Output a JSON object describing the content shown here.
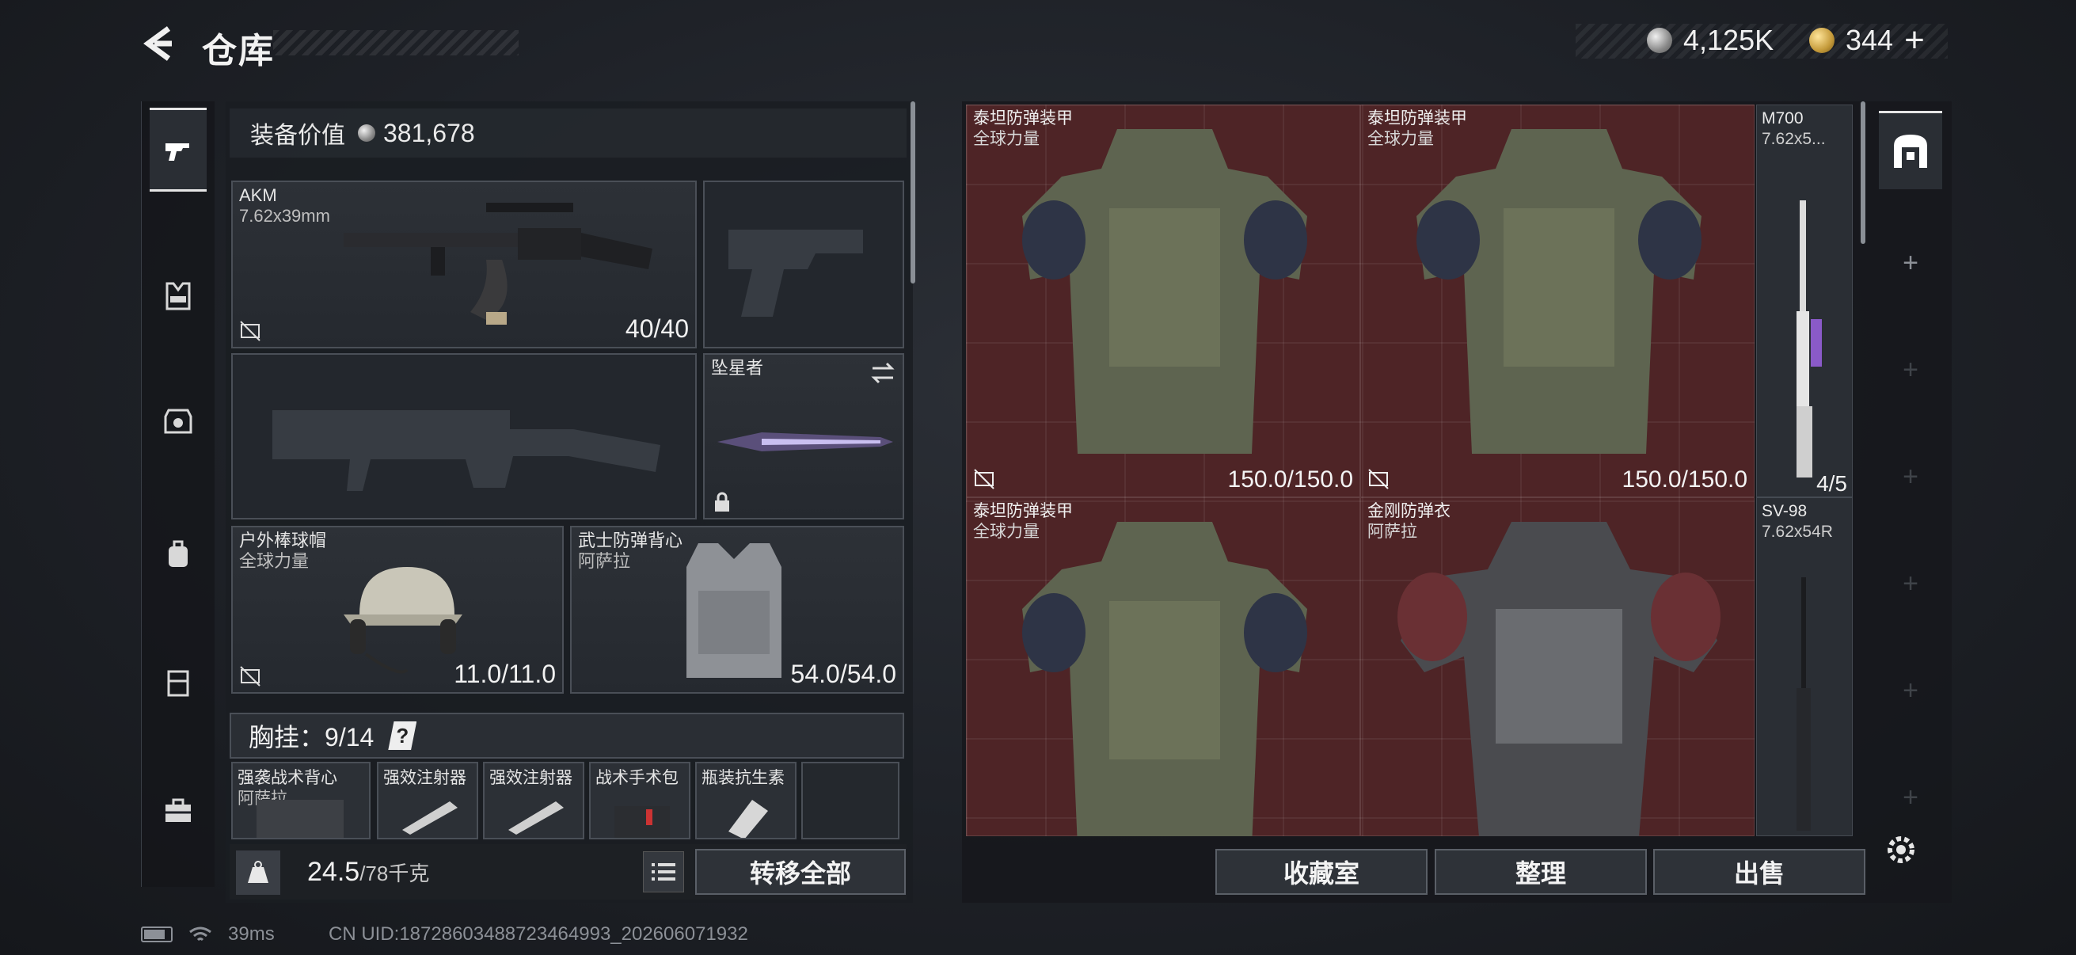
{
  "header": {
    "title": "仓库",
    "currency_silver": "4,125K",
    "currency_gold": "344",
    "plus_label": "+"
  },
  "loadout": {
    "value_label": "装备价值",
    "value": "381,678",
    "primary": {
      "name": "AKM",
      "ammo": "7.62x39mm",
      "stat": "40/40"
    },
    "melee": {
      "name": "坠星者"
    },
    "helmet": {
      "name": "户外棒球帽",
      "brand": "全球力量",
      "stat": "11.0/11.0"
    },
    "armor": {
      "name": "武士防弹背心",
      "brand": "阿萨拉",
      "stat": "54.0/54.0"
    },
    "chest": {
      "label": "胸挂：",
      "count": "9/14",
      "help": "?"
    },
    "chest_items": [
      {
        "name": "强袭战术背心",
        "brand": "阿萨拉"
      },
      {
        "name": "强效注射器"
      },
      {
        "name": "强效注射器"
      },
      {
        "name": "战术手术包"
      },
      {
        "name": "瓶装抗生素"
      }
    ],
    "weight_current": "24.5",
    "weight_max": "/78千克",
    "transfer_all": "转移全部"
  },
  "storage": {
    "cells": [
      {
        "name": "泰坦防弹装甲",
        "brand": "全球力量",
        "stat": "150.0/150.0"
      },
      {
        "name": "泰坦防弹装甲",
        "brand": "全球力量",
        "stat": "150.0/150.0"
      },
      {
        "name": "泰坦防弹装甲",
        "brand": "全球力量"
      },
      {
        "name": "金刚防弹衣",
        "brand": "阿萨拉"
      }
    ],
    "side_items": [
      {
        "name": "M700",
        "ammo": "7.62x5..."
      },
      {
        "name": "4/5"
      },
      {
        "name": "SV-98",
        "ammo": "7.62x54R"
      }
    ],
    "buttons": {
      "collection": "收藏室",
      "organize": "整理",
      "sell": "出售"
    }
  },
  "status": {
    "ping": "39ms",
    "uid": "CN UID:18728603488723464993_202606071932"
  },
  "colors": {
    "storage_bg": "#4e2426",
    "panel": "#23272d",
    "accent": "#e6e6e6"
  }
}
